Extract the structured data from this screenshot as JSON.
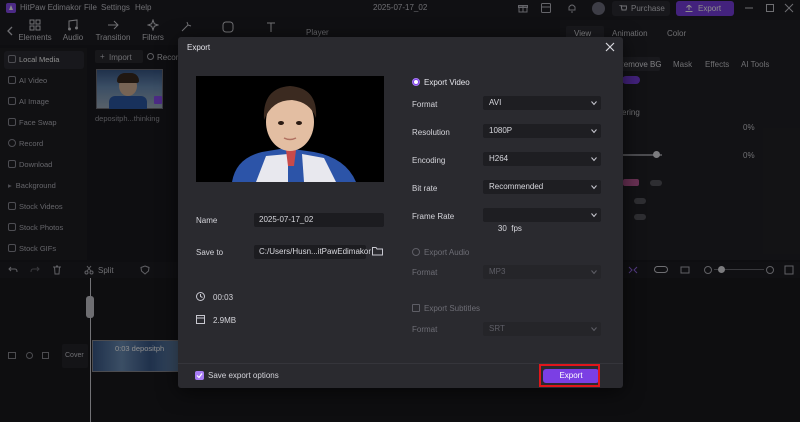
{
  "app": {
    "name": "HitPaw Edimakor",
    "menu": [
      "File",
      "Settings",
      "Help"
    ],
    "project_name": "2025-07-17_02",
    "purchase_label": "Purchase",
    "export_label": "Export"
  },
  "toolbar": {
    "items": [
      {
        "label": "Elements",
        "icon": "elements-icon"
      },
      {
        "label": "Audio",
        "icon": "audio-icon"
      },
      {
        "label": "Transition",
        "icon": "transition-icon"
      },
      {
        "label": "Filters",
        "icon": "filters-icon"
      }
    ]
  },
  "player": {
    "label": "Player"
  },
  "right_panel": {
    "tabs": [
      "View",
      "Animation",
      "Color"
    ],
    "subtabs": [
      "Remove BG",
      "Mask",
      "Effects",
      "AI Tools"
    ],
    "partial_texts": [
      "ering",
      "0%",
      "0%"
    ]
  },
  "left_nav": {
    "items": [
      "Local Media",
      "AI Video",
      "AI Image",
      "Face Swap",
      "Record",
      "Download",
      "Background",
      "Stock Videos",
      "Stock Photos",
      "Stock GIFs"
    ]
  },
  "media": {
    "import_label": "Import",
    "record_label": "Recor",
    "thumb_caption": "depositph...thinking"
  },
  "timeline": {
    "split_label": "Split",
    "cover_label": "Cover",
    "clip_label": "0:03 depositph"
  },
  "export_dialog": {
    "title": "Export",
    "name_label": "Name",
    "name_value": "2025-07-17_02",
    "save_to_label": "Save to",
    "save_to_value": "C:/Users/Husn...itPawEdimakor",
    "duration": "00:03",
    "size": "2.9MB",
    "export_video": {
      "title": "Export Video",
      "format_label": "Format",
      "format_value": "AVI",
      "resolution_label": "Resolution",
      "resolution_value": "1080P",
      "encoding_label": "Encoding",
      "encoding_value": "H264",
      "bitrate_label": "Bit rate",
      "bitrate_value": "Recommended",
      "framerate_label": "Frame Rate",
      "framerate_value": "30  fps"
    },
    "export_audio": {
      "title": "Export Audio",
      "format_label": "Format",
      "format_value": "MP3"
    },
    "export_subtitles": {
      "title": "Export Subtitles",
      "format_label": "Format",
      "format_value": "SRT"
    },
    "save_options_label": "Save export options",
    "export_button": "Export"
  },
  "colors": {
    "accent": "#7b3fe4",
    "highlight": "#e0161b"
  }
}
